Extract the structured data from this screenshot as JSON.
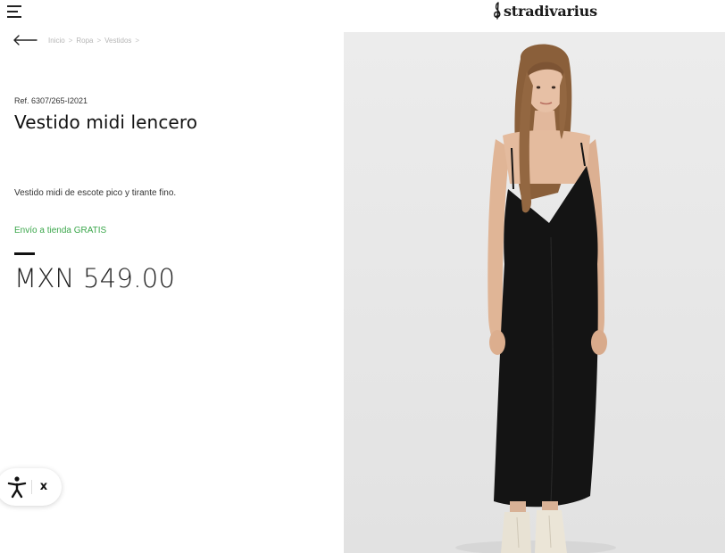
{
  "header": {
    "menu_icon": "hamburger-menu-icon",
    "brand": "stradivarius"
  },
  "breadcrumb": {
    "back_icon": "arrow-left-icon",
    "items": [
      "Inicio",
      "Ropa",
      "Vestidos"
    ],
    "separator": ">"
  },
  "product": {
    "ref": "Ref. 6307/265-I2021",
    "name": "Vestido midi lencero",
    "description": "Vestido midi de escote pico y tirante fino.",
    "shipping": "Envío a tienda GRATIS",
    "price": "MXN 549.00",
    "shipping_color": "#3aa64a",
    "dress_color": "#141414"
  },
  "accessibility_widget": {
    "icon": "accessibility-person-icon",
    "close_label": "x"
  }
}
